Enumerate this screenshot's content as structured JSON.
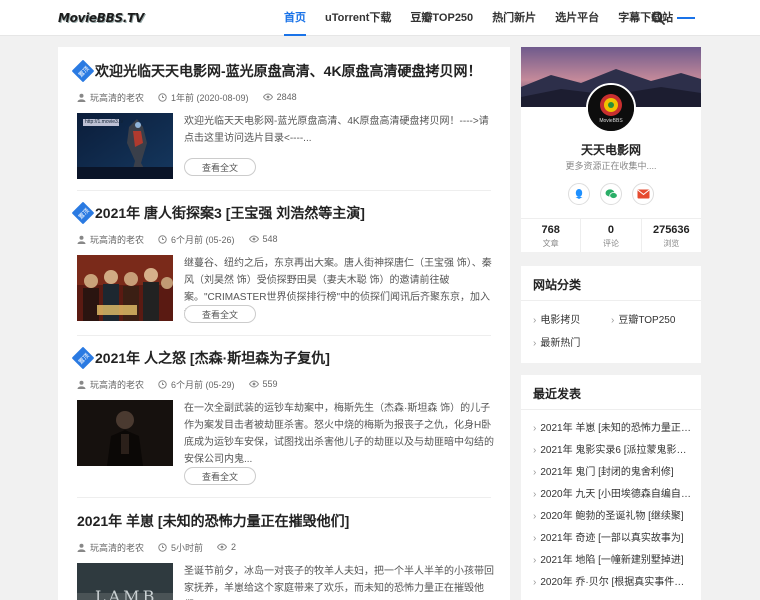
{
  "header": {
    "logo": "MovieBBS.TV",
    "nav": [
      "首页",
      "uTorrent下载",
      "豆瓣TOP250",
      "热门新片",
      "选片平台",
      "字幕下载站"
    ],
    "active_index": 0
  },
  "posts": [
    {
      "badge": "置顶",
      "title": "欢迎光临天天电影网-蓝光原盘高清、4K原盘高清硬盘拷贝网！",
      "author": "玩高清的老农",
      "time": "1年前 (2020-08-09)",
      "views": "2848",
      "excerpt": "欢迎光临天天电影网-蓝光原盘高清、4K原盘高清硬盘拷贝网！---->请点击这里访问选片目录<----...",
      "readmore": "查看全文",
      "thumb_text": "http://1.movie3.tv"
    },
    {
      "badge": "置顶",
      "title": "2021年 唐人街探案3 [王宝强 刘浩然等主演]",
      "author": "玩高清的老农",
      "time": "6个月前 (05-26)",
      "views": "548",
      "excerpt": "继蔓谷、纽约之后，东京再出大案。唐人街神探唐仁（王宝强 饰）、秦风（刘昊然 饰）受侦探野田昊（妻夫木聪 饰）的邀请前往破案。\"CRIMASTER世界侦探排行榜\"中的侦探们闻讯后齐聚东京，加入挑战，而...",
      "readmore": "查看全文"
    },
    {
      "badge": "置顶",
      "title": "2021年 人之怒 [杰森·斯坦森为子复仇]",
      "author": "玩高清的老农",
      "time": "6个月前 (05-29)",
      "views": "559",
      "excerpt": "在一次全副武装的运钞车劫案中，梅斯先生（杰森·斯坦森 饰）的儿子作为案发目击者被劫匪杀害。怒火中烧的梅斯为报丧子之仇，化身H卧底成为运钞车安保，试图找出杀害他儿子的劫匪以及与劫匪暗中勾结的安保公司内鬼...",
      "readmore": "查看全文"
    },
    {
      "title": "2021年 羊崽 [未知的恐怖力量正在摧毁他们]",
      "author": "玩高清的老农",
      "time": "5小时前",
      "views": "2",
      "excerpt": "圣诞节前夕，冰岛一对丧子的牧羊人夫妇，把一个半人半羊的小孩带回家抚养，羊崽给这个家庭带来了欢乐，而未知的恐怖力量正在摧毁他们。...",
      "thumb_text": "LAMB"
    }
  ],
  "profile": {
    "name": "天天电影网",
    "desc": "更多资源正在收集中....",
    "avatar_text": "MovieBBS",
    "stats": [
      {
        "num": "768",
        "label": "文章"
      },
      {
        "num": "0",
        "label": "评论"
      },
      {
        "num": "275636",
        "label": "浏览"
      }
    ]
  },
  "categories": {
    "title": "网站分类",
    "items": [
      "电影拷贝",
      "豆瓣TOP250",
      "最新热门"
    ]
  },
  "recent": {
    "title": "最近发表",
    "items": [
      "2021年 羊崽 [未知的恐怖力量正在摧毁他们]",
      "2021年 鬼影实录6 [派拉蒙鬼影实录系列]",
      "2021年 鬼门 [封闭的鬼舍利修]",
      "2020年 九天 [小田埃德森自编自导]",
      "2020年 鲍勃的圣诞礼物 [继续聚]",
      "2021年 奇迹 [一部以真实故事为]",
      "2021年 地陷 [一幢新建别墅掉进]",
      "2020年 乔·贝尔 [根据真实事件改编]"
    ]
  },
  "colors": {
    "accent": "#1a73e8",
    "badge": "#2a7ae2"
  }
}
